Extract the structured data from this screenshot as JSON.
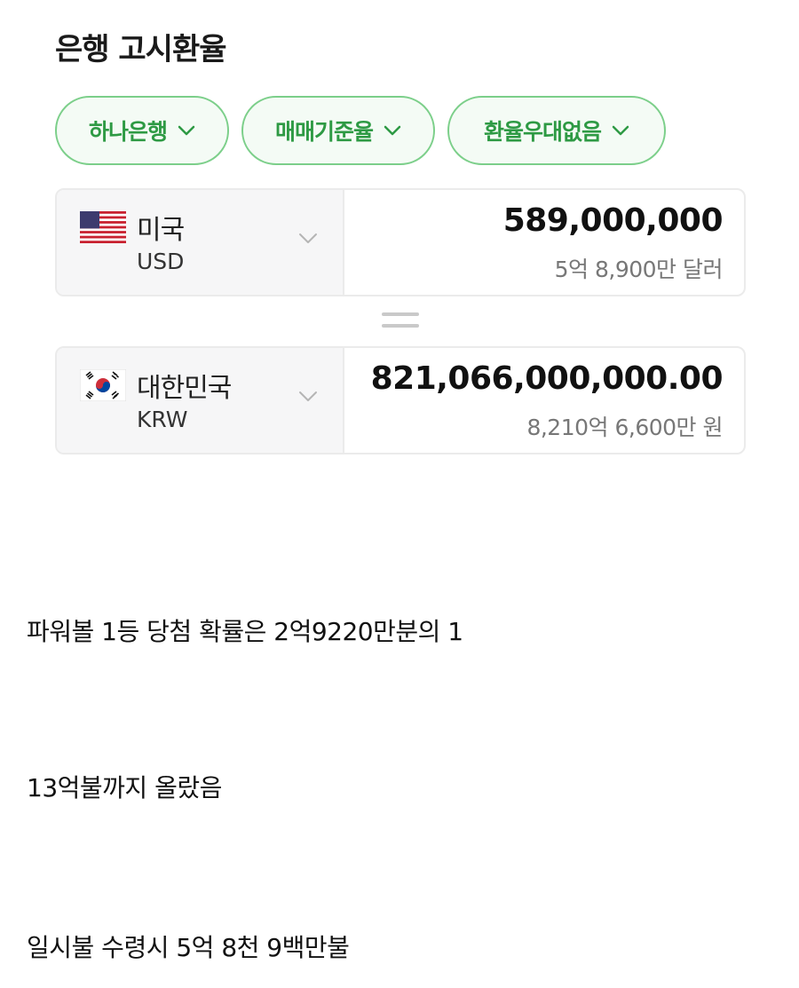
{
  "widget": {
    "title": "은행 고시환율",
    "filters": [
      {
        "label": "하나은행"
      },
      {
        "label": "매매기준율"
      },
      {
        "label": "환율우대없음"
      }
    ],
    "from": {
      "country": "미국",
      "code": "USD",
      "flag_icon": "us-flag-icon",
      "amount": "589,000,000",
      "amount_words": "5억 8,900만 달러"
    },
    "to": {
      "country": "대한민국",
      "code": "KRW",
      "flag_icon": "kr-flag-icon",
      "amount": "821,066,000,000.00",
      "amount_words": "8,210억 6,600만 원"
    },
    "accent_color": "#2e9a44"
  },
  "post": {
    "lines": [
      "파워볼 1등 당첨 확률은 2억9220만분의 1",
      "13억불까지 올랐음",
      "일시불 수령시 5억 8천 9백만불"
    ]
  }
}
